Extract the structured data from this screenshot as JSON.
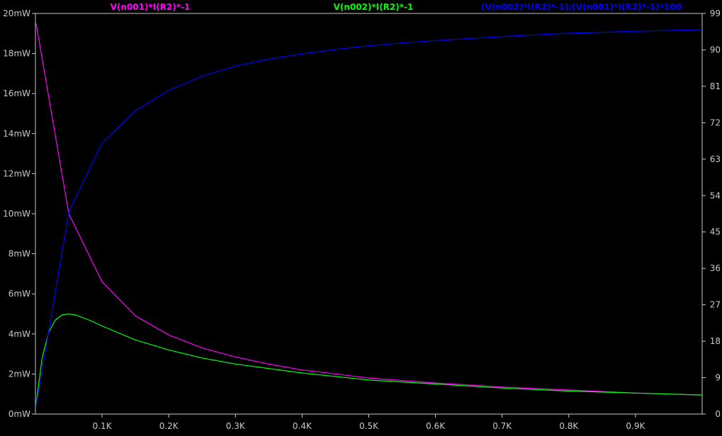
{
  "chart_data": {
    "type": "line",
    "title": "",
    "xlabel": "",
    "ylabel": "",
    "x_ticks": [
      "0.1K",
      "0.2K",
      "0.3K",
      "0.4K",
      "0.5K",
      "0.6K",
      "0.7K",
      "0.8K",
      "0.9K"
    ],
    "x_tick_values": [
      100,
      200,
      300,
      400,
      500,
      600,
      700,
      800,
      900
    ],
    "xlim": [
      0,
      1000
    ],
    "y_left_ticks": [
      "0mW",
      "2mW",
      "4mW",
      "6mW",
      "8mW",
      "10mW",
      "12mW",
      "14mW",
      "16mW",
      "18mW",
      "20mW"
    ],
    "y_left_tick_values": [
      0,
      2,
      4,
      6,
      8,
      10,
      12,
      14,
      16,
      18,
      20
    ],
    "ylim_left": [
      0,
      20
    ],
    "y_right_ticks": [
      "0",
      "9",
      "18",
      "27",
      "36",
      "45",
      "54",
      "63",
      "72",
      "81",
      "90",
      "99"
    ],
    "y_right_tick_values": [
      0,
      9,
      18,
      27,
      36,
      45,
      54,
      63,
      72,
      81,
      90,
      99
    ],
    "ylim_right": [
      0,
      99
    ],
    "grid": false,
    "legend_placement": "top",
    "series": [
      {
        "name": "V(n001)*I(R2)*-1",
        "color": "#ff00ff",
        "axis": "left",
        "x": [
          1,
          50,
          100,
          150,
          200,
          250,
          300,
          350,
          400,
          500,
          600,
          700,
          800,
          900,
          1000
        ],
        "values": [
          19.5,
          10.0,
          6.6,
          4.9,
          3.95,
          3.3,
          2.85,
          2.5,
          2.2,
          1.8,
          1.55,
          1.35,
          1.2,
          1.05,
          0.95
        ]
      },
      {
        "name": "V(n002)*I(R2)*-1",
        "color": "#00ff00",
        "axis": "left",
        "x": [
          1,
          10,
          20,
          30,
          40,
          50,
          60,
          80,
          100,
          150,
          200,
          250,
          300,
          400,
          500,
          600,
          700,
          800,
          900,
          1000
        ],
        "values": [
          0.5,
          2.8,
          4.1,
          4.7,
          4.95,
          5.0,
          4.95,
          4.7,
          4.4,
          3.7,
          3.2,
          2.8,
          2.5,
          2.05,
          1.7,
          1.5,
          1.3,
          1.15,
          1.05,
          0.95
        ]
      },
      {
        "name": "(V(n002)*I(R2)*-1)/(V(n001)*I(R2)*-1)*100",
        "color": "#0000ff",
        "axis": "right",
        "x": [
          1,
          50,
          100,
          150,
          200,
          250,
          300,
          350,
          400,
          450,
          500,
          550,
          600,
          700,
          800,
          900,
          1000
        ],
        "values": [
          2,
          50,
          67,
          75,
          80,
          83.5,
          86,
          87.7,
          89,
          90.1,
          91,
          91.7,
          92.3,
          93.3,
          94.1,
          94.6,
          95
        ]
      }
    ]
  }
}
